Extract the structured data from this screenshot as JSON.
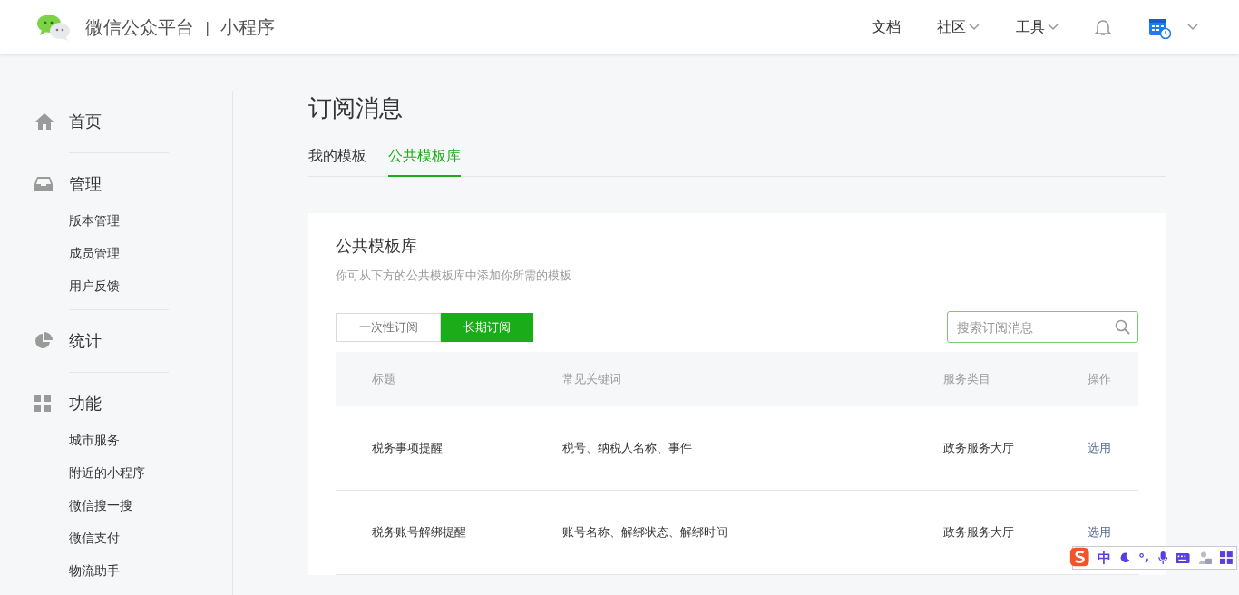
{
  "header": {
    "brand": "微信公众平台",
    "separator": "|",
    "product": "小程序",
    "nav": [
      {
        "label": "文档",
        "dropdown": false
      },
      {
        "label": "社区",
        "dropdown": true
      },
      {
        "label": "工具",
        "dropdown": true
      }
    ]
  },
  "sidebar": {
    "sections": [
      {
        "label": "首页",
        "kind": "home"
      },
      {
        "label": "管理",
        "kind": "inbox",
        "items": [
          "版本管理",
          "成员管理",
          "用户反馈"
        ]
      },
      {
        "label": "统计",
        "kind": "pie"
      },
      {
        "label": "功能",
        "kind": "grid",
        "items": [
          "城市服务",
          "附近的小程序",
          "微信搜一搜",
          "微信支付",
          "物流助手"
        ]
      }
    ]
  },
  "page_title": "订阅消息",
  "tabs": [
    {
      "label": "我的模板",
      "selected": false
    },
    {
      "label": "公共模板库",
      "selected": true
    }
  ],
  "card": {
    "title": "公共模板库",
    "description": "你可从下方的公共模板库中添加你所需的模板",
    "segments": [
      {
        "label": "一次性订阅",
        "selected": false
      },
      {
        "label": "长期订阅",
        "selected": true
      }
    ],
    "search": {
      "placeholder": "搜索订阅消息"
    },
    "table": {
      "columns": [
        "标题",
        "常见关键词",
        "服务类目",
        "操作"
      ],
      "rows": [
        {
          "title": "税务事项提醒",
          "keywords": "税号、纳税人名称、事件",
          "category": "政务服务大厅",
          "action": "选用"
        },
        {
          "title": "税务账号解绑提醒",
          "keywords": "账号名称、解绑状态、解绑时间",
          "category": "政务服务大厅",
          "action": "选用"
        }
      ]
    }
  },
  "ime": {
    "mode": "中"
  }
}
